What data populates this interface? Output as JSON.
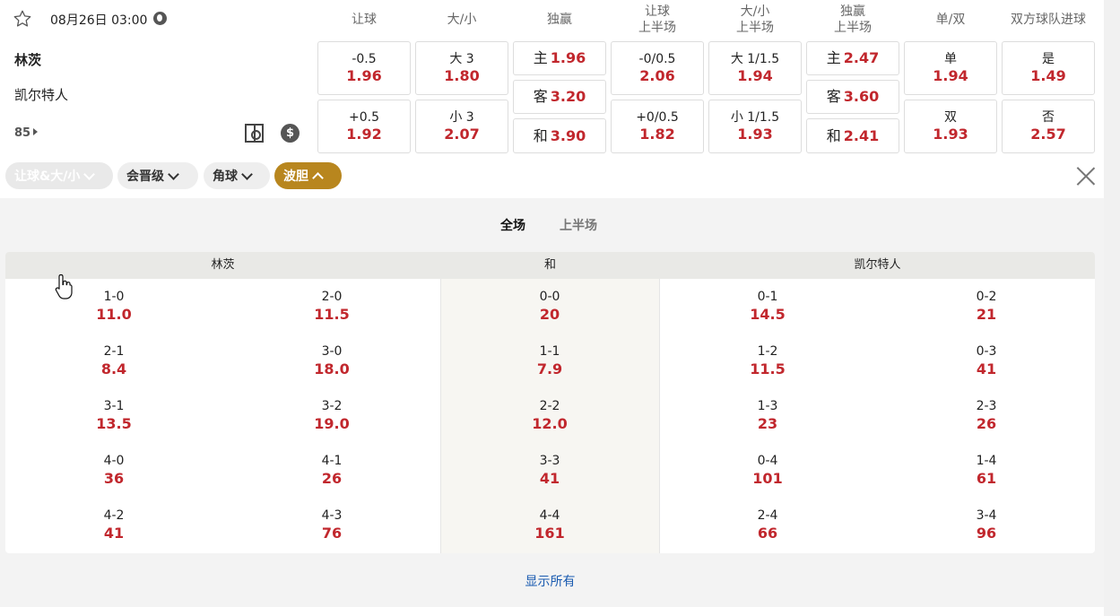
{
  "match": {
    "datetime": "08月26日 03:00",
    "home": "林茨",
    "away": "凯尔特人",
    "minute": "85"
  },
  "columns": [
    "让球",
    "大/小",
    "独赢",
    "让球\n上半场",
    "大/小\n上半场",
    "独赢\n上半场",
    "单/双",
    "双方球队进球"
  ],
  "odds": {
    "handicap": [
      {
        "lbl": "-0.5",
        "val": "1.96"
      },
      {
        "lbl": "+0.5",
        "val": "1.92"
      }
    ],
    "ou": [
      {
        "lbl": "大 3",
        "val": "1.80"
      },
      {
        "lbl": "小 3",
        "val": "2.07"
      }
    ],
    "moneyline": [
      {
        "lbl": "主",
        "val": "1.96"
      },
      {
        "lbl": "客",
        "val": "3.20"
      },
      {
        "lbl": "和",
        "val": "3.90"
      }
    ],
    "handicap_1h": [
      {
        "lbl": "-0/0.5",
        "val": "2.06"
      },
      {
        "lbl": "+0/0.5",
        "val": "1.82"
      }
    ],
    "ou_1h": [
      {
        "lbl": "大 1/1.5",
        "val": "1.94"
      },
      {
        "lbl": "小 1/1.5",
        "val": "1.93"
      }
    ],
    "moneyline_1h": [
      {
        "lbl": "主",
        "val": "2.47"
      },
      {
        "lbl": "客",
        "val": "3.60"
      },
      {
        "lbl": "和",
        "val": "2.41"
      }
    ],
    "oddeven": [
      {
        "lbl": "单",
        "val": "1.94"
      },
      {
        "lbl": "双",
        "val": "1.93"
      }
    ],
    "btts": [
      {
        "lbl": "是",
        "val": "1.49"
      },
      {
        "lbl": "否",
        "val": "2.57"
      }
    ]
  },
  "chips": [
    "让球&大/小",
    "会晋级",
    "角球",
    "波胆"
  ],
  "tabs": [
    "全场",
    "上半场"
  ],
  "grid_headers": {
    "home": "林茨",
    "draw": "和",
    "away": "凯尔特人"
  },
  "scores": [
    [
      {
        "sc": "1-0",
        "od": "11.0"
      },
      {
        "sc": "2-0",
        "od": "11.5"
      },
      {
        "sc": "0-0",
        "od": "20"
      },
      {
        "sc": "0-1",
        "od": "14.5"
      },
      {
        "sc": "0-2",
        "od": "21"
      }
    ],
    [
      {
        "sc": "2-1",
        "od": "8.4"
      },
      {
        "sc": "3-0",
        "od": "18.0"
      },
      {
        "sc": "1-1",
        "od": "7.9"
      },
      {
        "sc": "1-2",
        "od": "11.5"
      },
      {
        "sc": "0-3",
        "od": "41"
      }
    ],
    [
      {
        "sc": "3-1",
        "od": "13.5"
      },
      {
        "sc": "3-2",
        "od": "19.0"
      },
      {
        "sc": "2-2",
        "od": "12.0"
      },
      {
        "sc": "1-3",
        "od": "23"
      },
      {
        "sc": "2-3",
        "od": "26"
      }
    ],
    [
      {
        "sc": "4-0",
        "od": "36"
      },
      {
        "sc": "4-1",
        "od": "26"
      },
      {
        "sc": "3-3",
        "od": "41"
      },
      {
        "sc": "0-4",
        "od": "101"
      },
      {
        "sc": "1-4",
        "od": "61"
      }
    ],
    [
      {
        "sc": "4-2",
        "od": "41"
      },
      {
        "sc": "4-3",
        "od": "76"
      },
      {
        "sc": "4-4",
        "od": "161"
      },
      {
        "sc": "2-4",
        "od": "66"
      },
      {
        "sc": "3-4",
        "od": "96"
      }
    ]
  ],
  "show_all": "显示所有",
  "colors": {
    "accent": "#b8861e",
    "odds": "#c1272d",
    "link": "#1a5bb0"
  }
}
